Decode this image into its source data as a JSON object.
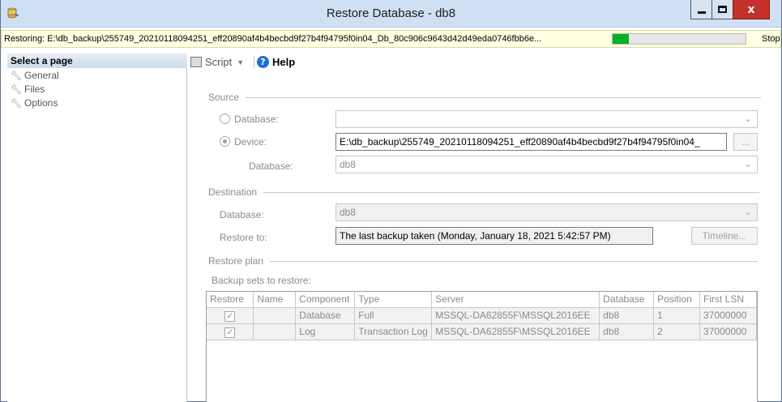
{
  "window": {
    "title": "Restore Database - db8",
    "close_glyph": "x"
  },
  "status": {
    "text": "Restoring: E:\\db_backup\\255749_20210118094251_eff20890af4b4becbd9f27b4f94795f0in04_Db_80c906c9643d42d49eda0746fbb6e...",
    "progress": 0.12,
    "progress_color": "#06b025",
    "stop_label": "Stop"
  },
  "sidebar": {
    "header": "Select a page",
    "items": [
      {
        "label": "General",
        "icon": "wrench-icon"
      },
      {
        "label": "Files",
        "icon": "wrench-icon"
      },
      {
        "label": "Options",
        "icon": "wrench-icon"
      }
    ]
  },
  "toolbar": {
    "script_label": "Script",
    "help_label": "Help"
  },
  "source": {
    "section_label": "Source",
    "database_radio_label": "Database:",
    "database_value": "",
    "device_radio_label": "Device:",
    "device_value": "E:\\db_backup\\255749_20210118094251_eff20890af4b4becbd9f27b4f94795f0in04_",
    "browse_label": "...",
    "device_database_label": "Database:",
    "device_database_value": "db8"
  },
  "destination": {
    "section_label": "Destination",
    "database_label": "Database:",
    "database_value": "db8",
    "restore_to_label": "Restore to:",
    "restore_to_value": "The last backup taken (Monday, January 18, 2021 5:42:57 PM)",
    "timeline_label": "Timeline..."
  },
  "restore_plan": {
    "section_label": "Restore plan",
    "backup_sets_label": "Backup sets to restore:",
    "columns": [
      "Restore",
      "Name",
      "Component",
      "Type",
      "Server",
      "Database",
      "Position",
      "First LSN"
    ],
    "rows": [
      {
        "restore": true,
        "name": "",
        "component": "Database",
        "type": "Full",
        "server": "MSSQL-DA62855F\\MSSQL2016EE",
        "database": "db8",
        "position": "1",
        "first_lsn": "37000000"
      },
      {
        "restore": true,
        "name": "",
        "component": "Log",
        "type": "Transaction Log",
        "server": "MSSQL-DA62855F\\MSSQL2016EE",
        "database": "db8",
        "position": "2",
        "first_lsn": "37000000"
      }
    ]
  }
}
